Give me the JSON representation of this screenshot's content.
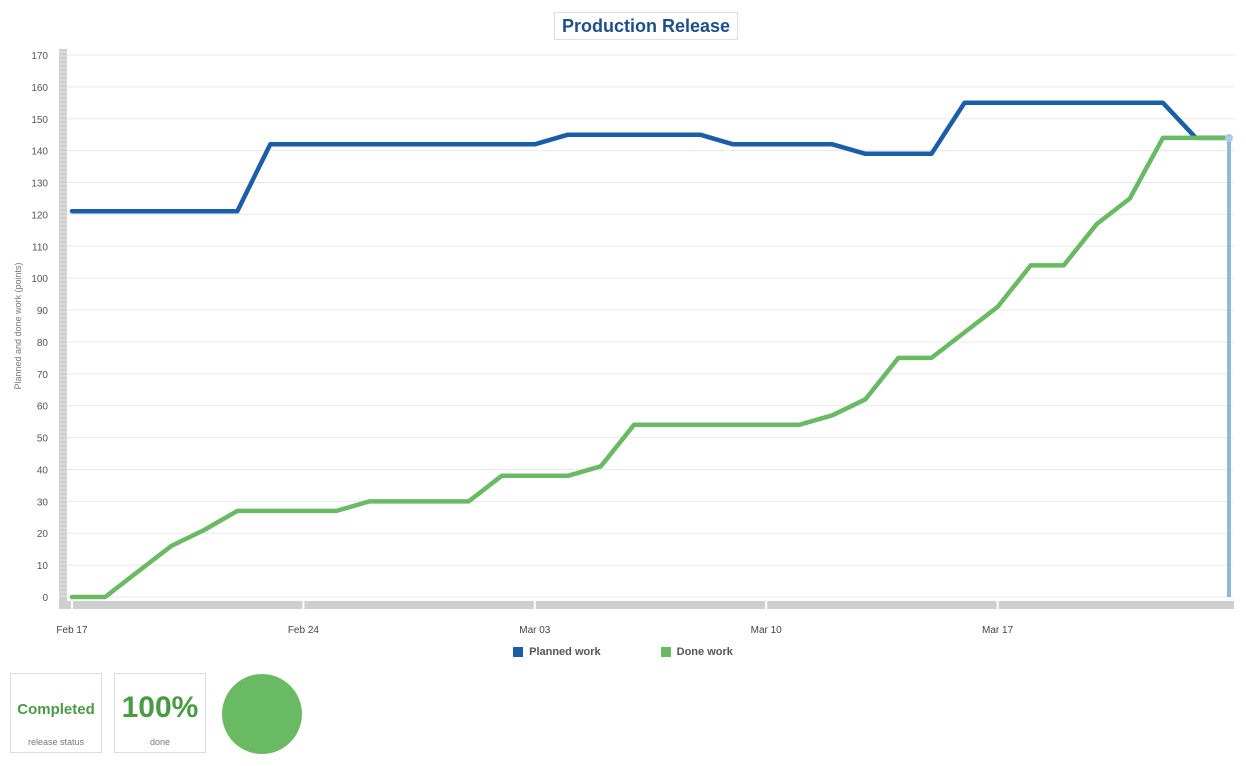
{
  "chart_data": {
    "type": "line",
    "title": "Production Release",
    "ylabel": "Planned and done work (points)",
    "xlabel": "",
    "ylim": [
      0,
      170
    ],
    "yticks": [
      0,
      10,
      20,
      30,
      40,
      50,
      60,
      70,
      80,
      90,
      100,
      110,
      120,
      130,
      140,
      150,
      160,
      170
    ],
    "xticks": [
      "Feb 17",
      "Feb 24",
      "Mar 03",
      "Mar 10",
      "Mar 17"
    ],
    "x": [
      "Feb 17",
      "Feb 18",
      "Feb 19",
      "Feb 20",
      "Feb 21",
      "Feb 22",
      "Feb 23",
      "Feb 24",
      "Feb 25",
      "Feb 26",
      "Feb 27",
      "Feb 28",
      "Mar 01",
      "Mar 02",
      "Mar 03",
      "Mar 04",
      "Mar 05",
      "Mar 06",
      "Mar 07",
      "Mar 08",
      "Mar 09",
      "Mar 10",
      "Mar 11",
      "Mar 12",
      "Mar 13",
      "Mar 14",
      "Mar 15",
      "Mar 16",
      "Mar 17",
      "Mar 18",
      "Mar 19",
      "Mar 20",
      "Mar 21",
      "Mar 22",
      "Mar 23",
      "Mar 24"
    ],
    "series": [
      {
        "name": "Planned work",
        "color": "#1a5ea8",
        "values": [
          121,
          121,
          121,
          121,
          121,
          121,
          142,
          142,
          142,
          142,
          142,
          142,
          142,
          142,
          142,
          145,
          145,
          145,
          145,
          145,
          142,
          142,
          142,
          142,
          139,
          139,
          139,
          155,
          155,
          155,
          155,
          155,
          155,
          155,
          144,
          144
        ]
      },
      {
        "name": "Done work",
        "color": "#6aba64",
        "values": [
          0,
          0,
          8,
          16,
          21,
          27,
          27,
          27,
          27,
          30,
          30,
          30,
          30,
          38,
          38,
          38,
          41,
          54,
          54,
          54,
          54,
          54,
          54,
          57,
          62,
          75,
          75,
          83,
          91,
          104,
          104,
          117,
          125,
          144,
          144,
          144
        ]
      }
    ],
    "today_marker": "Mar 24",
    "grid": true,
    "legend_position": "bottom"
  },
  "summary": {
    "status_value": "Completed",
    "status_label": "release status",
    "percent_value": "100%",
    "percent_label": "done",
    "indicator_color": "#6aba64"
  }
}
